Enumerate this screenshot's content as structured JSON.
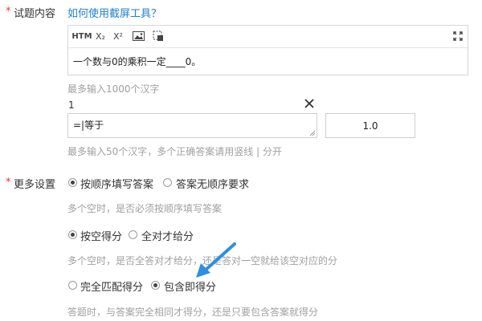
{
  "content_section": {
    "required_mark": "*",
    "label": "试题内容",
    "help_link": "如何使用截屏工具？",
    "toolbar": {
      "html_label": "HTM",
      "subscript_label": "X₂",
      "superscript_label": "X²",
      "image_icon": "image-icon",
      "screenshot_icon": "screenshot-icon",
      "fullscreen_icon": "fullscreen-icon"
    },
    "content_text": "一个数与0的乘积一定____0。",
    "hint": "最多输入1000个汉字"
  },
  "answer_section": {
    "blank_number": "1",
    "answer_value": "=|等于",
    "score_value": "1.0",
    "hint": "最多输入50个汉字，多个正确答案请用竖线 | 分开"
  },
  "more_settings": {
    "required_mark": "*",
    "label": "更多设置",
    "groups": [
      {
        "options": [
          {
            "label": "按顺序填写答案",
            "checked": true
          },
          {
            "label": "答案无顺序要求",
            "checked": false
          }
        ],
        "hint": "多个空时，是否必须按顺序填写答案"
      },
      {
        "options": [
          {
            "label": "按空得分",
            "checked": true
          },
          {
            "label": "全对才给分",
            "checked": false
          }
        ],
        "hint": "多个空时，是否全答对才给分，还是答对一空就给该空对应的分"
      },
      {
        "options": [
          {
            "label": "完全匹配得分",
            "checked": false
          },
          {
            "label": "包含即得分",
            "checked": true
          }
        ],
        "hint": "答题时，与答案完全相同才得分，还是只要包含答案就得分"
      }
    ]
  },
  "colors": {
    "accent_link": "#1e7fcd",
    "required_star": "#e4393c",
    "annotation_arrow": "#2f8fde",
    "hint_text": "#a0a0a0"
  }
}
